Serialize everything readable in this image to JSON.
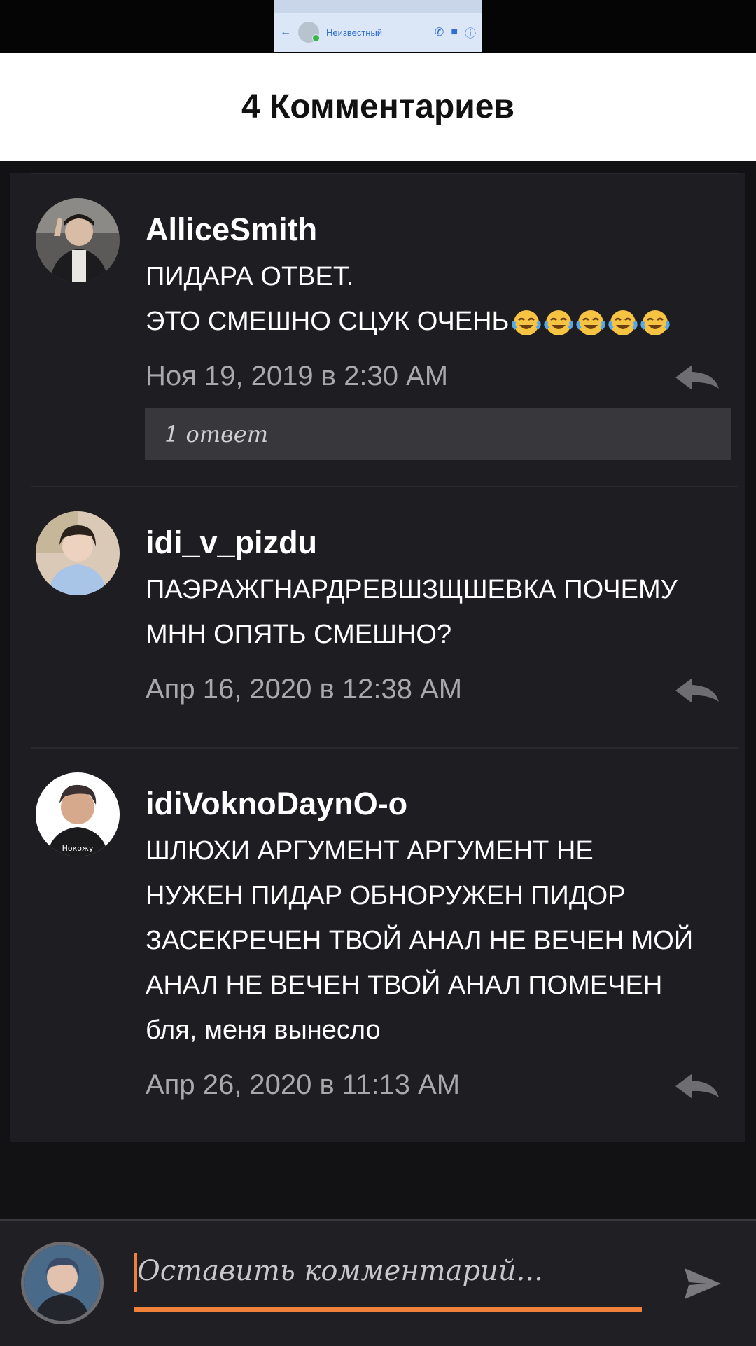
{
  "call_thumbnail": {
    "contact_name": "Неизвестный"
  },
  "header": {
    "title": "4 Комментариев"
  },
  "comments": [
    {
      "author": "AlliceSmith",
      "lines": [
        "ПИДАРА ОТВЕТ.",
        "ЭТО СМЕШНО СЦУК ОЧЕНЬ"
      ],
      "emoji_count": 5,
      "date": "Ноя 19, 2019 в 2:30 AM",
      "replies_label": "1 ответ"
    },
    {
      "author": "idi_v_pizdu",
      "lines": [
        "ПАЭРАЖГНАРДРЕВШЗЩШЕВКА ПОЧЕМУ",
        "МНН ОПЯТЬ СМЕШНО?"
      ],
      "date": "Апр 16, 2020 в 12:38 AM"
    },
    {
      "author": "idiVoknoDaynO-o",
      "avatar_caption": "Нокожу",
      "lines": [
        "ШЛЮХИ АРГУМЕНТ АРГУМЕНТ НЕ",
        "НУЖЕН ПИДАР ОБНОРУЖЕН ПИДОР",
        "ЗАСЕКРЕЧЕН ТВОЙ АНАЛ НЕ ВЕЧЕН МОЙ",
        "АНАЛ НЕ ВЕЧЕН ТВОЙ АНАЛ ПОМЕЧЕН",
        "бля, меня вынесло"
      ],
      "date": "Апр 26, 2020 в 11:13 AM"
    }
  ],
  "compose": {
    "placeholder": "Оставить комментарий..."
  },
  "colors": {
    "accent": "#f0813b",
    "background": "#121114",
    "card": "#1e1d21",
    "date_text": "#a9a8ad",
    "header_bg": "#ffffff"
  },
  "icons": {
    "reply": "reply-arrow-icon",
    "send": "send-icon",
    "emoji": "face-with-tears-of-joy-icon"
  }
}
